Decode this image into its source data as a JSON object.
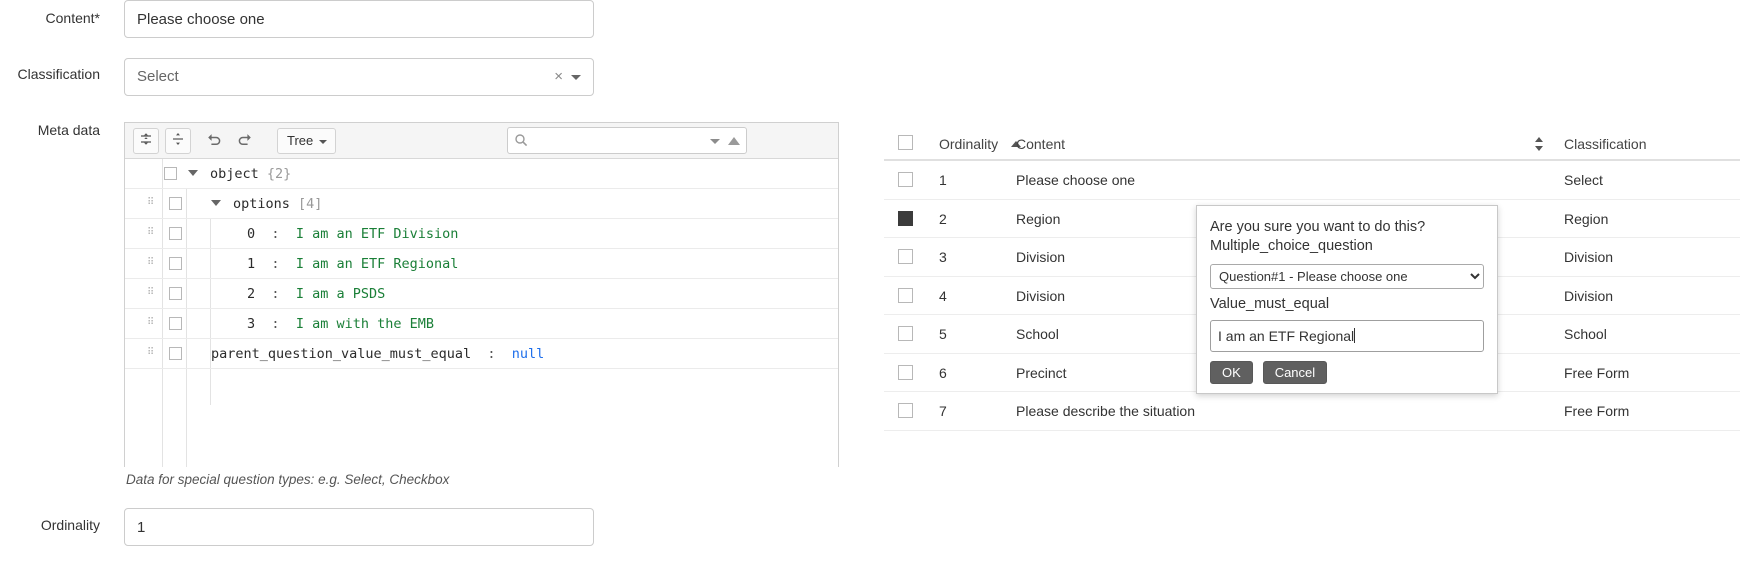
{
  "form": {
    "content": {
      "label": "Content*",
      "value": "Please choose one"
    },
    "classification": {
      "label": "Classification",
      "value": "Select",
      "clear_icon": "times-icon"
    },
    "meta_data": {
      "label": "Meta data",
      "footnote": "Data for special question types: e.g. Select, Checkbox"
    },
    "ordinality": {
      "label": "Ordinality",
      "value": "1"
    }
  },
  "json_editor": {
    "toolbar": {
      "expand_icon": "expand-all-icon",
      "collapse_icon": "collapse-all-icon",
      "undo_icon": "undo-icon",
      "redo_icon": "redo-icon",
      "mode_label": "Tree",
      "search_icon": "search-icon",
      "search_placeholder": "",
      "search_value": ""
    },
    "rows": [
      {
        "key": "object",
        "count": "{2}",
        "indent": 0,
        "type": "object",
        "expanded": true,
        "has_drag": false
      },
      {
        "key": "options",
        "count": "[4]",
        "indent": 1,
        "type": "array",
        "expanded": true,
        "has_drag": true
      },
      {
        "key": "0",
        "value": "I am an ETF Division",
        "indent": 2,
        "type": "string",
        "has_drag": true
      },
      {
        "key": "1",
        "value": "I am an ETF Regional",
        "indent": 2,
        "type": "string",
        "has_drag": true
      },
      {
        "key": "2",
        "value": "I am a PSDS",
        "indent": 2,
        "type": "string",
        "has_drag": true
      },
      {
        "key": "3",
        "value": "I am with the EMB",
        "indent": 2,
        "type": "string",
        "has_drag": true
      },
      {
        "key": "parent_question_value_must_equal",
        "value": "null",
        "indent": 1,
        "type": "null",
        "has_drag": true
      }
    ]
  },
  "table": {
    "select_all_checkbox": false,
    "columns": [
      {
        "label": "Ordinality",
        "sort": "asc"
      },
      {
        "label": "Content",
        "sort": "none"
      },
      {
        "label": "Classification",
        "sort": "none"
      }
    ],
    "rows": [
      {
        "checked": false,
        "ordinality": "1",
        "content": "Please choose one",
        "classification": "Select"
      },
      {
        "checked": true,
        "ordinality": "2",
        "content": "Region",
        "classification": "Region"
      },
      {
        "checked": false,
        "ordinality": "3",
        "content": "Division",
        "classification": "Division"
      },
      {
        "checked": false,
        "ordinality": "4",
        "content": "Division",
        "classification": "Division"
      },
      {
        "checked": false,
        "ordinality": "5",
        "content": "School",
        "classification": "School"
      },
      {
        "checked": false,
        "ordinality": "6",
        "content": "Precinct",
        "classification": "Free Form"
      },
      {
        "checked": false,
        "ordinality": "7",
        "content": "Please describe the situation",
        "classification": "Free Form"
      }
    ]
  },
  "modal": {
    "question_line1": "Are you sure you want to do this?",
    "question_line2": "Multiple_choice_question",
    "select_value": "Question#1 - Please choose one",
    "select_options": [
      "Question#1 - Please choose one"
    ],
    "value_label": "Value_must_equal",
    "input_value": "I am an ETF Regional",
    "ok_label": "OK",
    "cancel_label": "Cancel"
  }
}
